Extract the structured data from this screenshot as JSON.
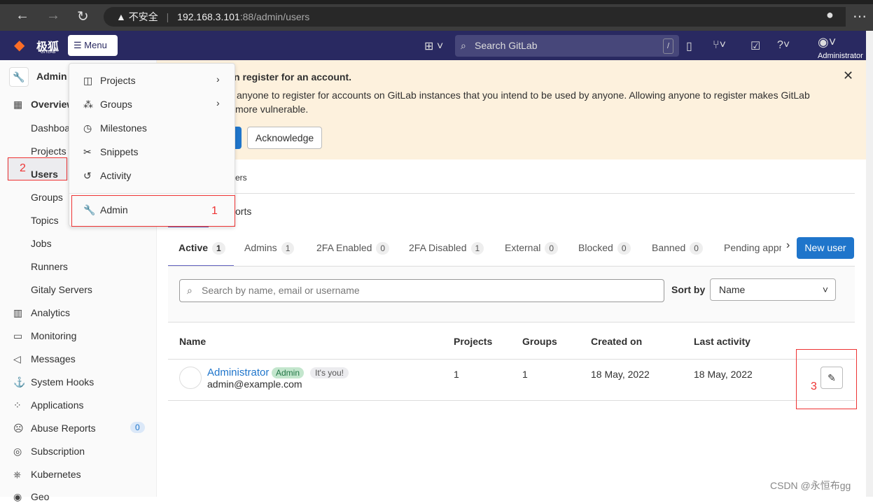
{
  "browser": {
    "security": "不安全",
    "url_host": "192.168.3.101",
    "url_rest": ":88/admin/users"
  },
  "nav": {
    "brand": "极狐",
    "brand_sub": "GITLAB",
    "menu": "Menu",
    "search_placeholder": "Search GitLab",
    "search_key": "/",
    "user": "Administrator"
  },
  "sidebar": {
    "header": "Admin",
    "items": [
      {
        "label": "Overview",
        "icon": "grid-icon"
      },
      {
        "label": "Dashboard"
      },
      {
        "label": "Projects"
      },
      {
        "label": "Users"
      },
      {
        "label": "Groups"
      },
      {
        "label": "Topics"
      },
      {
        "label": "Jobs"
      },
      {
        "label": "Runners"
      },
      {
        "label": "Gitaly Servers"
      },
      {
        "label": "Analytics",
        "icon": "chart-icon"
      },
      {
        "label": "Monitoring",
        "icon": "monitor-icon"
      },
      {
        "label": "Messages",
        "icon": "megaphone-icon"
      },
      {
        "label": "System Hooks",
        "icon": "anchor-icon"
      },
      {
        "label": "Applications",
        "icon": "apps-icon"
      },
      {
        "label": "Abuse Reports",
        "icon": "face-icon",
        "count": "0"
      },
      {
        "label": "Subscription",
        "icon": "subscription-icon"
      },
      {
        "label": "Kubernetes",
        "icon": "kubernetes-icon"
      },
      {
        "label": "Geo",
        "icon": "geo-icon"
      }
    ]
  },
  "dropdown": {
    "items": [
      "Projects",
      "Groups",
      "Milestones",
      "Snippets",
      "Activity",
      "Admin"
    ]
  },
  "banner": {
    "title": "n register for an account.",
    "body1": "anyone to register for accounts on GitLab instances that you intend to be used by anyone. Allowing anyone to register makes GitLab",
    "body2": "more vulnerable.",
    "ack": "Acknowledge"
  },
  "behind": {
    "a": "ers",
    "b": "orts"
  },
  "tabs": [
    {
      "label": "Active",
      "count": "1"
    },
    {
      "label": "Admins",
      "count": "1"
    },
    {
      "label": "2FA Enabled",
      "count": "0"
    },
    {
      "label": "2FA Disabled",
      "count": "1"
    },
    {
      "label": "External",
      "count": "0"
    },
    {
      "label": "Blocked",
      "count": "0"
    },
    {
      "label": "Banned",
      "count": "0"
    },
    {
      "label": "Pending appr",
      "count": ""
    }
  ],
  "new_user": "New user",
  "filter": {
    "placeholder": "Search by name, email or username",
    "sort_label": "Sort by",
    "sort_value": "Name"
  },
  "table": {
    "headers": [
      "Name",
      "Projects",
      "Groups",
      "Created on",
      "Last activity"
    ],
    "rows": [
      {
        "name": "Administrator",
        "badge_admin": "Admin",
        "badge_you": "It's you!",
        "email": "admin@example.com",
        "projects": "1",
        "groups": "1",
        "created": "18 May, 2022",
        "last": "18 May, 2022"
      }
    ]
  },
  "annotations": [
    "1",
    "2",
    "3"
  ],
  "watermark": "CSDN @永恒布gg",
  "colors": {
    "nav": "#292961",
    "banner": "#fdf1dd",
    "primary": "#1f75cb",
    "annotation": "#e33333"
  }
}
